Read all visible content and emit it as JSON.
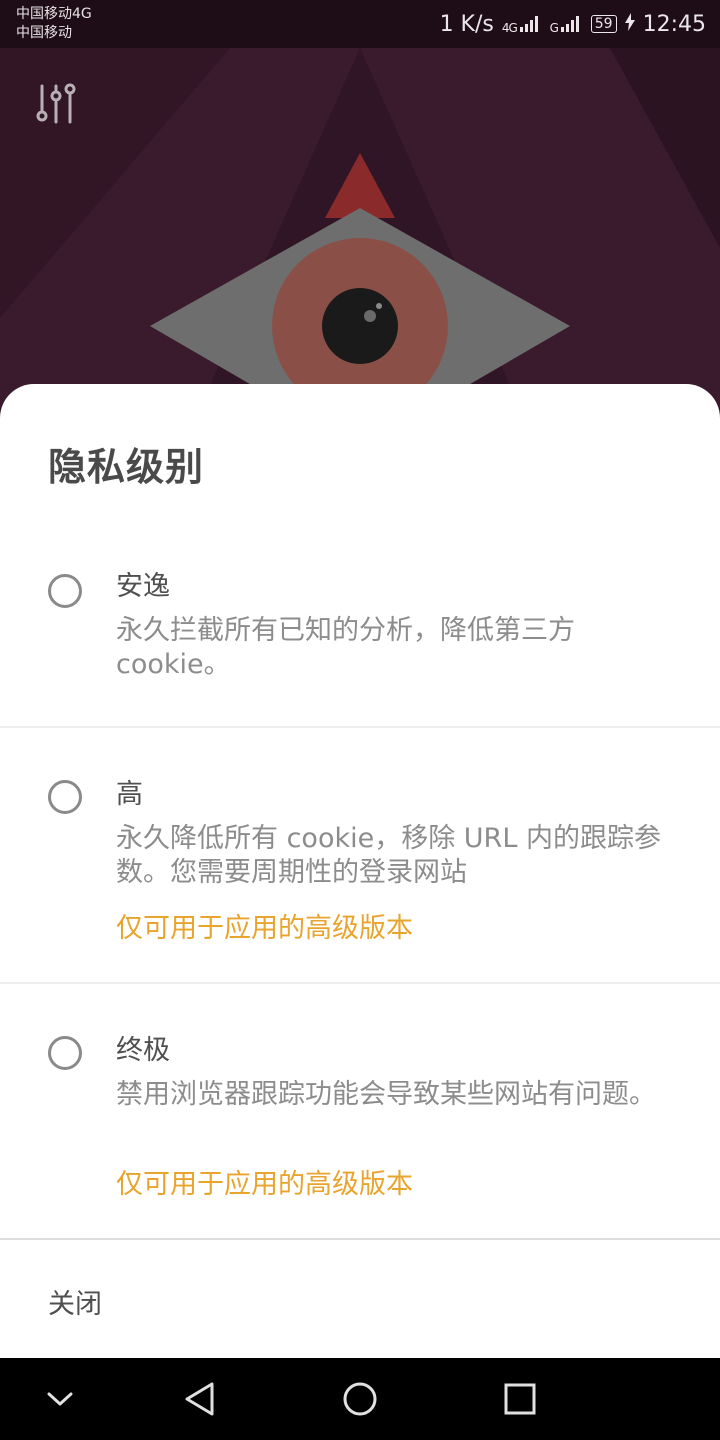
{
  "status_bar": {
    "carrier_1": "中国移动4G",
    "carrier_2": "中国移动",
    "net_speed": "1 K/s",
    "sim1_signal": "4G",
    "sim2_signal": "G",
    "battery": "59",
    "time": "12:45"
  },
  "header": {
    "settings_icon": "sliders-icon"
  },
  "sheet": {
    "title": "隐私级别",
    "options": [
      {
        "title": "安逸",
        "description": "永久拦截所有已知的分析，降低第三方cookie。",
        "premium_note": ""
      },
      {
        "title": "高",
        "description": "永久降低所有 cookie，移除 URL 内的跟踪参数。您需要周期性的登录网站",
        "premium_note": "仅可用于应用的高级版本"
      },
      {
        "title": "终极",
        "description": "禁用浏览器跟踪功能会导致某些网站有问题。",
        "premium_note": "仅可用于应用的高级版本"
      }
    ],
    "close_label": "关闭"
  },
  "nav_bar": {
    "icons": [
      "chevron-down-icon",
      "back-icon",
      "home-icon",
      "recents-icon"
    ]
  },
  "colors": {
    "accent_premium": "#e8a42d",
    "hero_bg": "#3a1a2d"
  }
}
